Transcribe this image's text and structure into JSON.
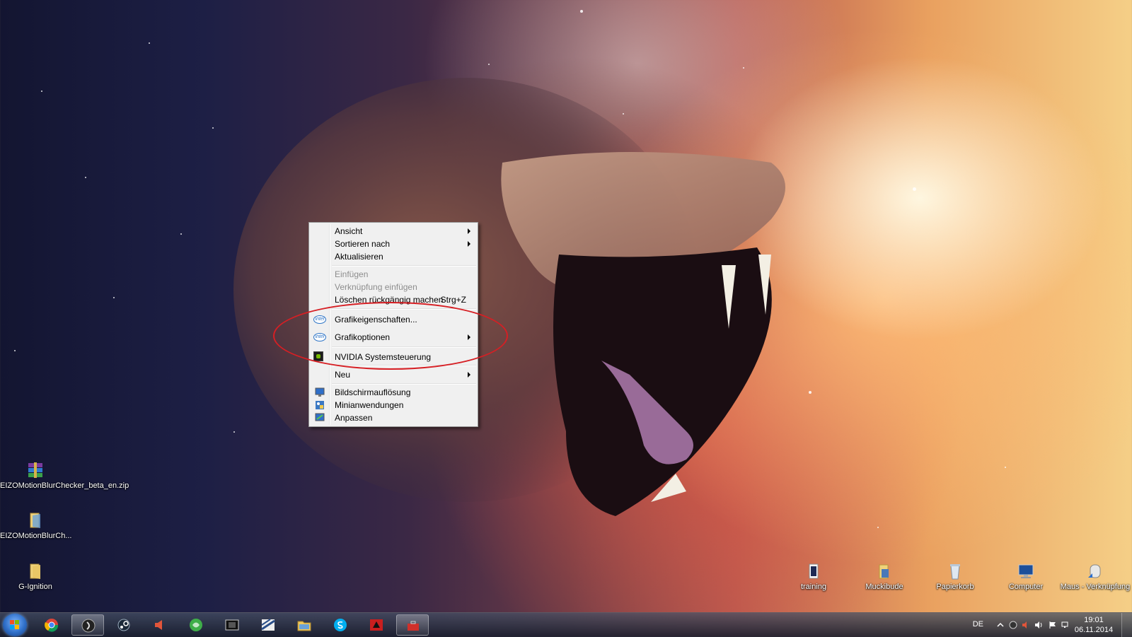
{
  "desktop": {
    "icons_left": [
      {
        "label": "EIZOMotionBlurChecker_beta_en.zip",
        "icon": "winrar-archive-icon"
      },
      {
        "label": "EIZOMotionBlurCh...",
        "icon": "folder-icon"
      },
      {
        "label": "G-Ignition",
        "icon": "folder-icon"
      }
    ],
    "icons_right": [
      {
        "label": "training",
        "icon": "folder-doc-icon"
      },
      {
        "label": "Muckibude",
        "icon": "folder-doc-icon"
      },
      {
        "label": "Papierkorb",
        "icon": "recycle-bin-icon"
      },
      {
        "label": "Computer",
        "icon": "computer-icon"
      },
      {
        "label": "Maus - Verknüpfung",
        "icon": "shortcut-icon"
      }
    ]
  },
  "context_menu": {
    "items": [
      {
        "label": "Ansicht",
        "submenu": true,
        "enabled": true
      },
      {
        "label": "Sortieren nach",
        "submenu": true,
        "enabled": true
      },
      {
        "label": "Aktualisieren",
        "enabled": true
      },
      {
        "label": "Einfügen",
        "enabled": false
      },
      {
        "label": "Verknüpfung einfügen",
        "enabled": false
      },
      {
        "label": "Löschen rückgängig machen",
        "shortcut": "Strg+Z",
        "enabled": true
      },
      {
        "label": "Grafikeigenschaften...",
        "icon": "intel-icon",
        "icon_text": "intel",
        "enabled": true
      },
      {
        "label": "Grafikoptionen",
        "icon": "intel-icon",
        "icon_text": "intel",
        "submenu": true,
        "enabled": true
      },
      {
        "label": "NVIDIA Systemsteuerung",
        "icon": "nvidia-icon",
        "enabled": true
      },
      {
        "label": "Neu",
        "submenu": true,
        "enabled": true
      },
      {
        "label": "Bildschirmauflösung",
        "icon": "display-icon",
        "enabled": true
      },
      {
        "label": "Minianwendungen",
        "icon": "gadgets-icon",
        "enabled": true
      },
      {
        "label": "Anpassen",
        "icon": "personalize-icon",
        "enabled": true
      }
    ]
  },
  "annotation": {
    "color": "#d61f24"
  },
  "taskbar": {
    "apps": [
      {
        "name": "chrome-icon"
      },
      {
        "name": "dark-app-icon",
        "active": true
      },
      {
        "name": "steam-icon"
      },
      {
        "name": "speaker-app-icon"
      },
      {
        "name": "green-app-icon"
      },
      {
        "name": "film-app-icon"
      },
      {
        "name": "stripes-app-icon"
      },
      {
        "name": "explorer-icon"
      },
      {
        "name": "skype-icon"
      },
      {
        "name": "red-app-icon"
      },
      {
        "name": "toolbox-icon",
        "active": true
      }
    ],
    "tray": {
      "language": "DE",
      "time": "19:01",
      "date": "06.11.2014"
    }
  }
}
